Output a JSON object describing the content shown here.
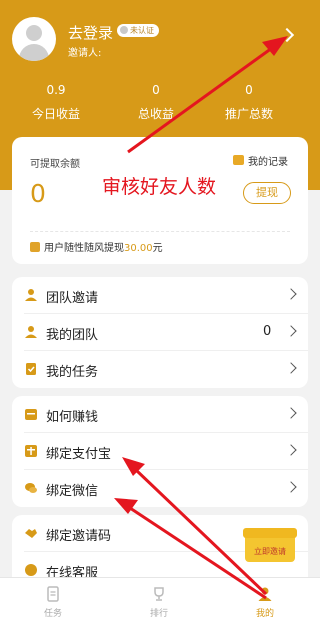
{
  "header": {
    "login_text": "去登录",
    "badge": "未认证",
    "inviter_label": "邀请人:"
  },
  "stats": [
    {
      "value": "0.9",
      "label": "今日收益"
    },
    {
      "value": "0",
      "label": "总收益"
    },
    {
      "value": "0",
      "label": "推广总数"
    }
  ],
  "balance": {
    "title": "可提取余额",
    "amount": "0",
    "records_label": "我的记录",
    "withdraw_label": "提现",
    "annotation": "审核好友人数",
    "notice_prefix": "用户随性随风提现",
    "notice_amount": "30.00",
    "notice_suffix": "元"
  },
  "menu_group1": [
    {
      "label": "团队邀请",
      "icon": "team-invite-icon"
    },
    {
      "label": "我的团队",
      "icon": "my-team-icon",
      "value": "0"
    },
    {
      "label": "我的任务",
      "icon": "task-icon"
    }
  ],
  "menu_group2": [
    {
      "label": "如何赚钱",
      "icon": "money-icon"
    },
    {
      "label": "绑定支付宝",
      "icon": "alipay-icon"
    },
    {
      "label": "绑定微信",
      "icon": "wechat-icon"
    }
  ],
  "menu_group3": [
    {
      "label": "绑定邀请码",
      "icon": "handshake-icon"
    },
    {
      "label": "在线客服",
      "icon": "customer-service-icon"
    }
  ],
  "invite_float": {
    "label": "立即邀请"
  },
  "tabs": [
    {
      "label": "任务",
      "icon": "task-tab-icon",
      "active": false
    },
    {
      "label": "排行",
      "icon": "trophy-icon",
      "active": false
    },
    {
      "label": "我的",
      "icon": "user-tab-icon",
      "active": true
    }
  ],
  "colors": {
    "brand": "#d79a18",
    "annotation": "#e4161f",
    "arrow": "#e4161f"
  }
}
